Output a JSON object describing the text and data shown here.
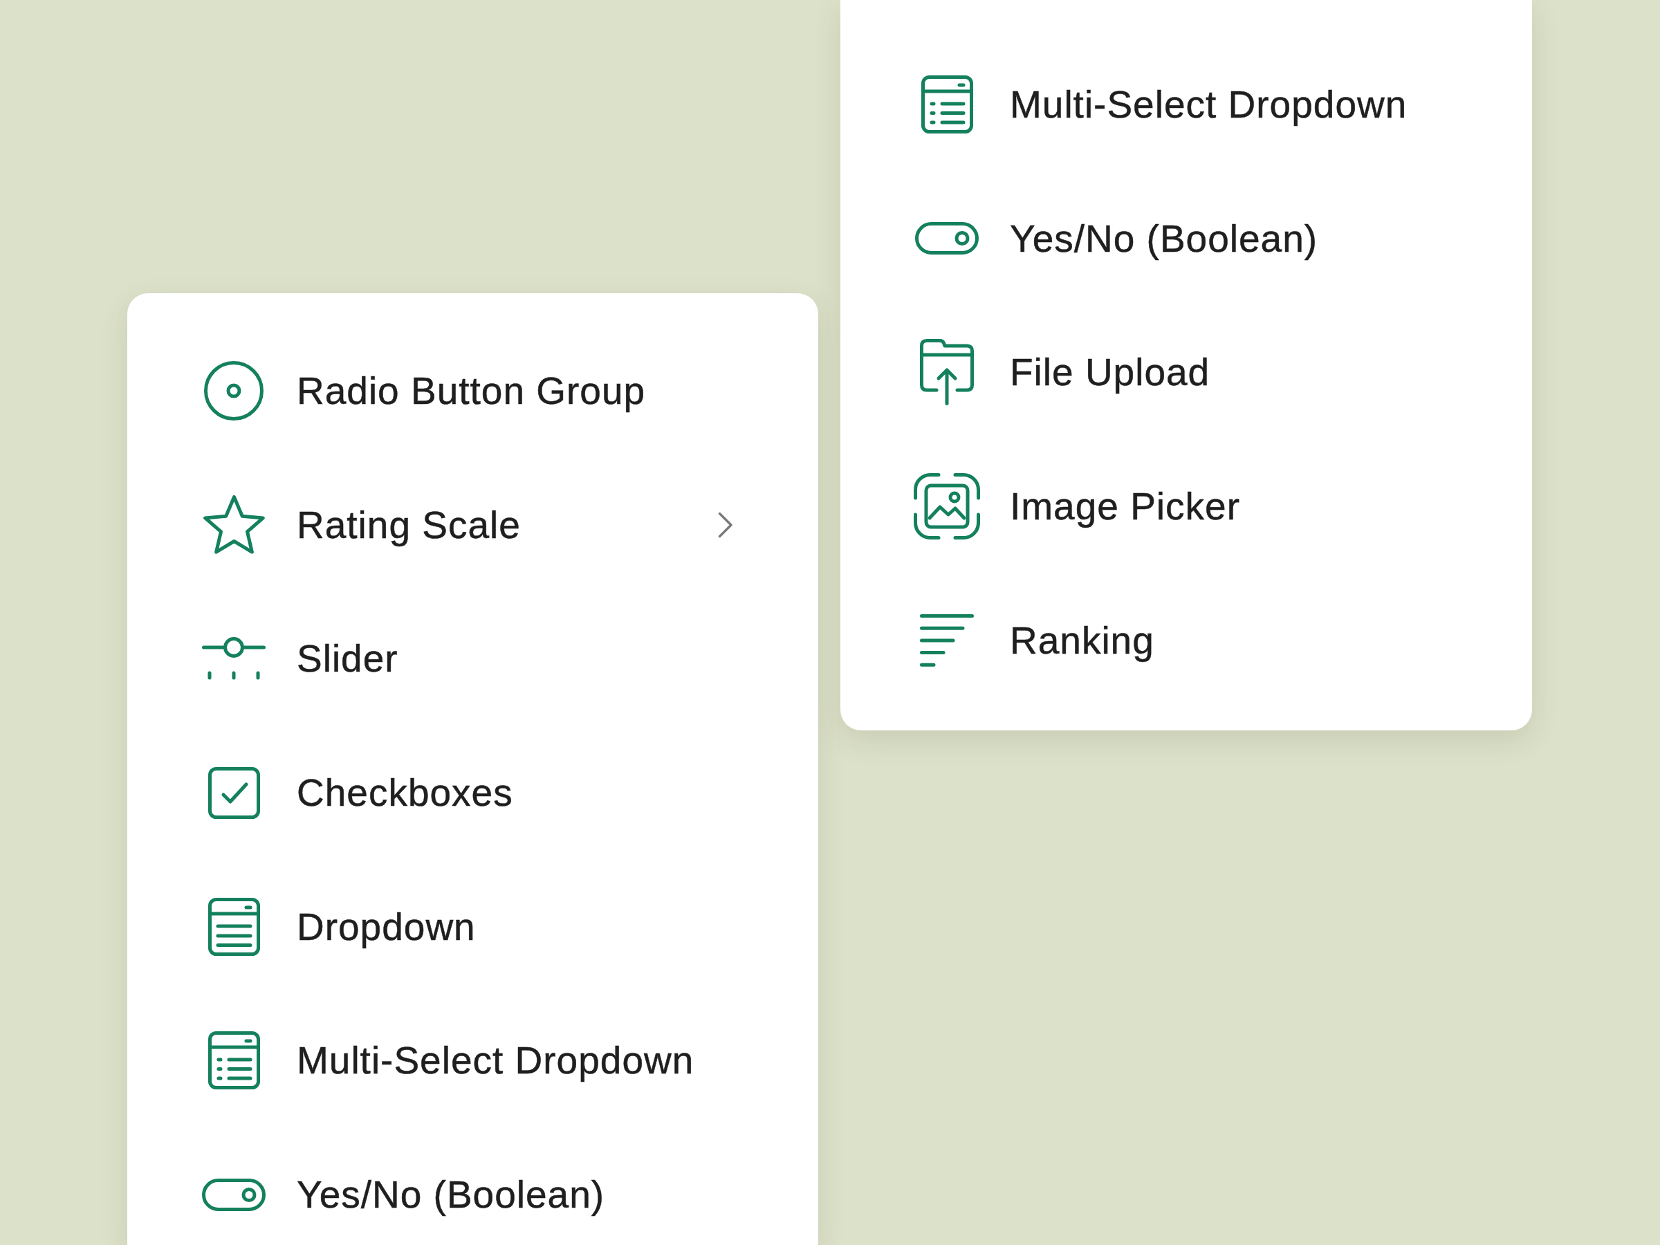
{
  "panels": [
    {
      "items": [
        {
          "kind": "radio",
          "label": "Radio Button Group",
          "submenu": false
        },
        {
          "kind": "rating",
          "label": "Rating Scale",
          "submenu": true
        },
        {
          "kind": "slider",
          "label": "Slider",
          "submenu": false
        },
        {
          "kind": "checkbox",
          "label": "Checkboxes",
          "submenu": false
        },
        {
          "kind": "dropdown",
          "label": "Dropdown",
          "submenu": false
        },
        {
          "kind": "multiselect",
          "label": "Multi-Select Dropdown",
          "submenu": false
        },
        {
          "kind": "boolean",
          "label": "Yes/No (Boolean)",
          "submenu": false
        }
      ]
    },
    {
      "items": [
        {
          "kind": "multiselect",
          "label": "Multi-Select Dropdown",
          "submenu": false
        },
        {
          "kind": "boolean",
          "label": "Yes/No (Boolean)",
          "submenu": false
        },
        {
          "kind": "file",
          "label": "File Upload",
          "submenu": false
        },
        {
          "kind": "image",
          "label": "Image Picker",
          "submenu": false
        },
        {
          "kind": "ranking",
          "label": "Ranking",
          "submenu": false
        }
      ]
    }
  ]
}
